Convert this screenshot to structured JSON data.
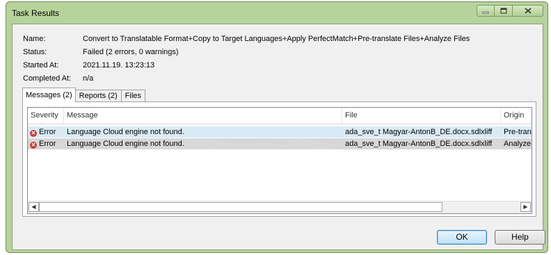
{
  "window": {
    "title": "Task Results",
    "caption_buttons": [
      "minimize",
      "maximize",
      "close"
    ]
  },
  "info": [
    {
      "label": "Name:",
      "value": "Convert to Translatable Format+Copy to Target Languages+Apply PerfectMatch+Pre-translate Files+Analyze Files"
    },
    {
      "label": "Status:",
      "value": "Failed (2 errors, 0 warnings)"
    },
    {
      "label": "Started At:",
      "value": "2021.11.19. 13:23:13"
    },
    {
      "label": "Completed At:",
      "value": "n/a"
    }
  ],
  "tabs": [
    {
      "label": "Messages (2)",
      "active": true
    },
    {
      "label": "Reports (2)",
      "active": false
    },
    {
      "label": "Files",
      "active": false
    }
  ],
  "grid": {
    "columns": [
      "Severity",
      "Message",
      "File",
      "Origin"
    ],
    "rows": [
      {
        "severity": "Error",
        "message": "Language Cloud engine not found.",
        "file": "ada_sve_t Magyar-AntonB_DE.docx.sdlxliff",
        "origin": "Pre-translate"
      },
      {
        "severity": "Error",
        "message": "Language Cloud engine not found.",
        "file": "ada_sve_t Magyar-AntonB_DE.docx.sdlxliff",
        "origin": "Analyze"
      }
    ]
  },
  "buttons": {
    "ok": "OK",
    "help": "Help"
  },
  "icons": {
    "error": "error-circle-x-icon",
    "scroll_left": "arrow-left-icon",
    "scroll_right": "arrow-right-icon"
  },
  "colors": {
    "frame": "#b7d39b",
    "selected_row": "#d9eaf7",
    "error_icon": "#c8393a"
  }
}
